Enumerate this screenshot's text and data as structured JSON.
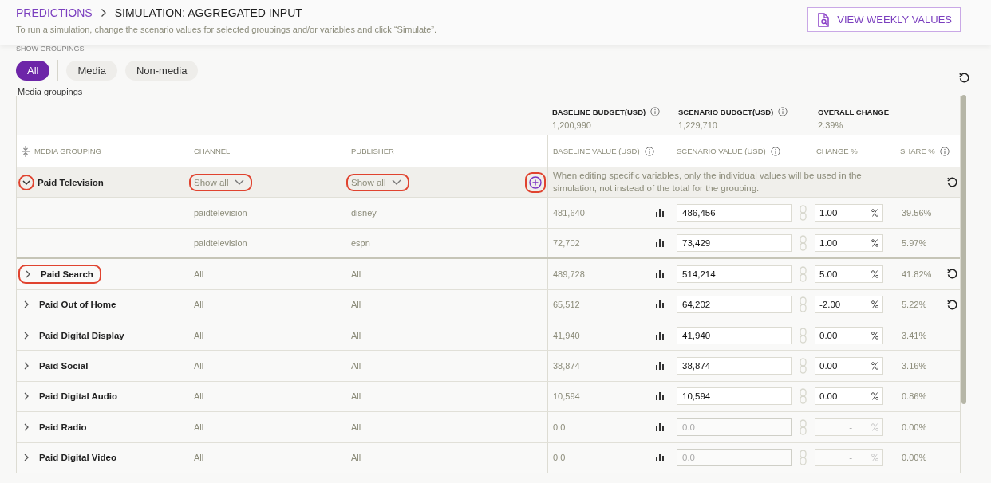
{
  "header": {
    "breadcrumb": [
      {
        "label": "PREDICTIONS",
        "kind": "link"
      },
      {
        "label": "SIMULATION: AGGREGATED INPUT",
        "kind": "current"
      }
    ],
    "subtitle": "To run a simulation, change the scenario values for selected groupings and/or variables and click “Simulate”.",
    "view_button": "VIEW WEEKLY VALUES"
  },
  "filters": {
    "label": "SHOW GROUPINGS",
    "chips": [
      {
        "label": "All",
        "selected": true
      },
      {
        "label": "Media",
        "selected": false
      },
      {
        "label": "Non-media",
        "selected": false
      }
    ]
  },
  "section": {
    "title": "Media groupings"
  },
  "summary": [
    {
      "label": "BASELINE BUDGET(USD)",
      "value": "1,200,990",
      "info": true
    },
    {
      "label": "SCENARIO BUDGET(USD)",
      "value": "1,229,710",
      "info": true
    },
    {
      "label": "OVERALL CHANGE",
      "value": "2.39%",
      "info": false
    }
  ],
  "columns": [
    {
      "label": "MEDIA GROUPING",
      "info": false
    },
    {
      "label": "CHANNEL",
      "info": false
    },
    {
      "label": "PUBLISHER",
      "info": false
    },
    {
      "label": "BASELINE VALUE (USD)",
      "info": true
    },
    {
      "label": "SCENARIO VALUE (USD)",
      "info": true
    },
    {
      "label": "CHANGE %",
      "info": false
    },
    {
      "label": "SHARE %",
      "info": true
    }
  ],
  "rows": [
    {
      "kind": "filter",
      "name": "Paid Television",
      "expanded": true,
      "circled": true,
      "channel_filter": {
        "label": "Show all",
        "circled": true
      },
      "publisher_filter": {
        "label": "Show all",
        "circled": true
      },
      "add_circled": true,
      "note": "When editing specific variables, only the individual values will be used in the simulation, not instead of the total for the grouping.",
      "reset": true
    },
    {
      "kind": "variable",
      "channel": "paidtelevision",
      "publisher": "disney",
      "baseline": "481,640",
      "scenario": "486,456",
      "change": "1.00",
      "share": "39.56%",
      "disabled": false,
      "reset": false
    },
    {
      "kind": "variable",
      "channel": "paidtelevision",
      "publisher": "espn",
      "baseline": "72,702",
      "scenario": "73,429",
      "change": "1.00",
      "share": "5.97%",
      "disabled": false,
      "reset": false
    },
    {
      "kind": "group",
      "name": "Paid Search",
      "expanded": false,
      "circled": true,
      "channel": "All",
      "publisher": "All",
      "baseline": "489,728",
      "scenario": "514,214",
      "change": "5.00",
      "share": "41.82%",
      "disabled": false,
      "reset": true
    },
    {
      "kind": "group",
      "name": "Paid Out of Home",
      "expanded": false,
      "circled": false,
      "channel": "All",
      "publisher": "All",
      "baseline": "65,512",
      "scenario": "64,202",
      "change": "-2.00",
      "share": "5.22%",
      "disabled": false,
      "reset": true
    },
    {
      "kind": "group",
      "name": "Paid Digital Display",
      "expanded": false,
      "circled": false,
      "channel": "All",
      "publisher": "All",
      "baseline": "41,940",
      "scenario": "41,940",
      "change": "0.00",
      "share": "3.41%",
      "disabled": false,
      "reset": false
    },
    {
      "kind": "group",
      "name": "Paid Social",
      "expanded": false,
      "circled": false,
      "channel": "All",
      "publisher": "All",
      "baseline": "38,874",
      "scenario": "38,874",
      "change": "0.00",
      "share": "3.16%",
      "disabled": false,
      "reset": false
    },
    {
      "kind": "group",
      "name": "Paid Digital Audio",
      "expanded": false,
      "circled": false,
      "channel": "All",
      "publisher": "All",
      "baseline": "10,594",
      "scenario": "10,594",
      "change": "0.00",
      "share": "0.86%",
      "disabled": false,
      "reset": false
    },
    {
      "kind": "group",
      "name": "Paid Radio",
      "expanded": false,
      "circled": false,
      "channel": "All",
      "publisher": "All",
      "baseline": "0.0",
      "scenario": "0.0",
      "change": "-",
      "share": "0.00%",
      "disabled": true,
      "reset": false
    },
    {
      "kind": "group",
      "name": "Paid Digital Video",
      "expanded": false,
      "circled": false,
      "channel": "All",
      "publisher": "All",
      "baseline": "0.0",
      "scenario": "0.0",
      "change": "-",
      "share": "0.00%",
      "disabled": true,
      "reset": false
    }
  ]
}
